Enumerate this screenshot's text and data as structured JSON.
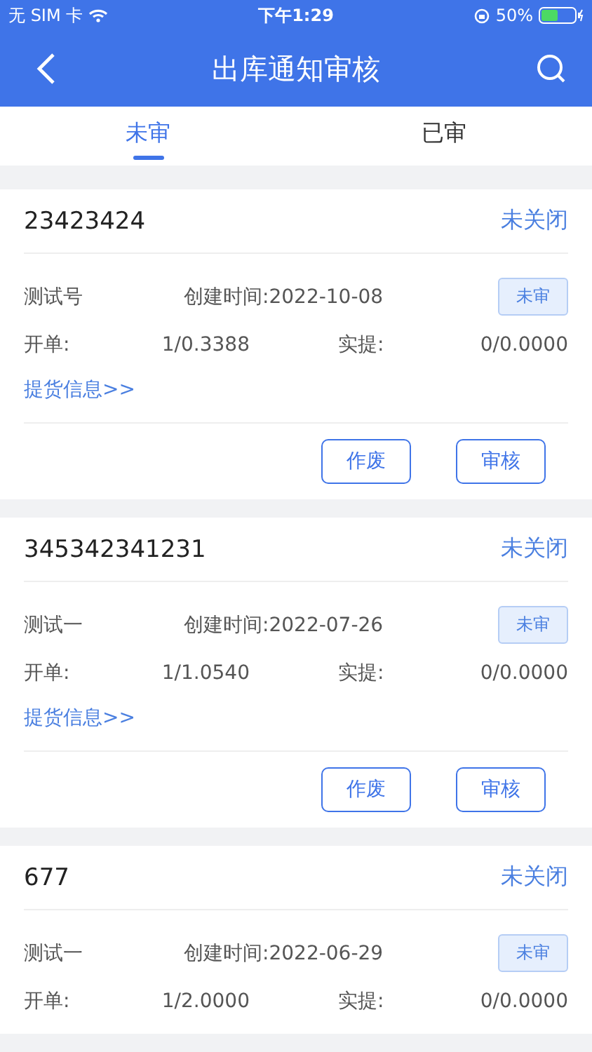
{
  "status_bar": {
    "carrier": "无 SIM 卡",
    "time": "下午1:29",
    "battery": "50%"
  },
  "nav": {
    "title": "出库通知审核"
  },
  "tabs": [
    {
      "label": "未审",
      "selected": true
    },
    {
      "label": "已审",
      "selected": false
    }
  ],
  "orders": [
    {
      "number": "23423424",
      "close_status": "未关闭",
      "name": "测试号",
      "created": "创建时间:2022-10-08",
      "status": "未审",
      "billed_label": "开单:",
      "billed": "1/0.3388",
      "picked_label": "实提:",
      "picked": "0/0.0000",
      "link": "提货信息>>",
      "buttons": [
        "作废",
        "审核"
      ]
    },
    {
      "number": "345342341231",
      "close_status": "未关闭",
      "name": "测试一",
      "created": "创建时间:2022-07-26",
      "status": "未审",
      "billed_label": "开单:",
      "billed": "1/1.0540",
      "picked_label": "实提:",
      "picked": "0/0.0000",
      "link": "提货信息>>",
      "buttons": [
        "作废",
        "审核"
      ]
    },
    {
      "number": "677",
      "close_status": "未关闭",
      "name": "测试一",
      "created": "创建时间:2022-06-29",
      "status": "未审",
      "billed_label": "开单:",
      "billed": "1/2.0000",
      "picked_label": "实提:",
      "picked": "0/0.0000"
    }
  ]
}
